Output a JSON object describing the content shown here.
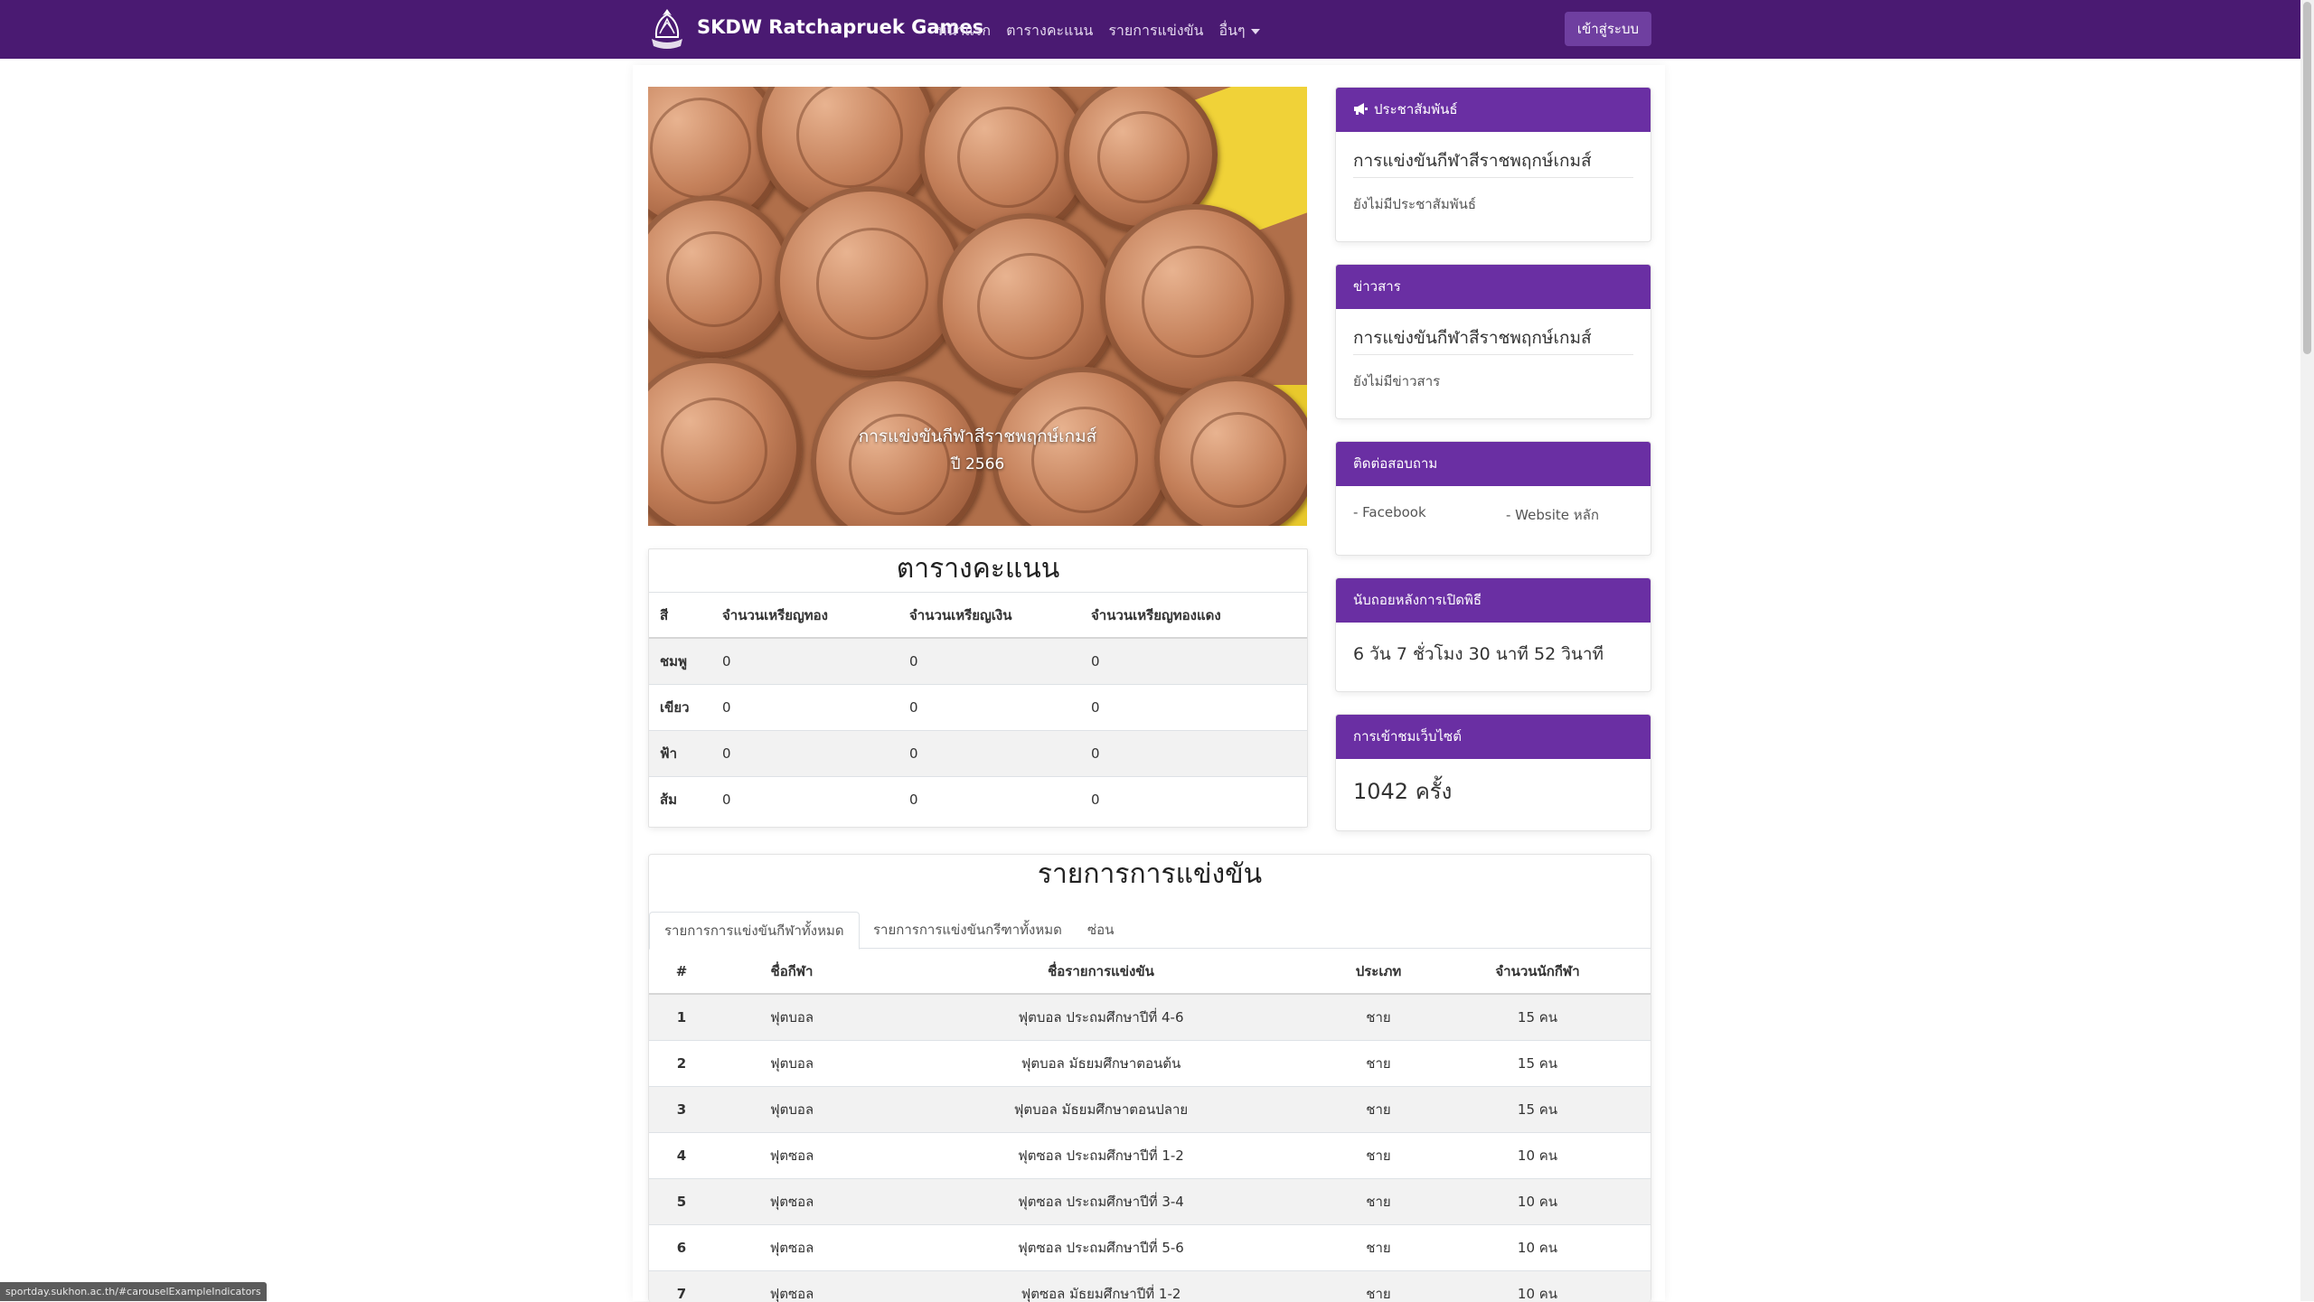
{
  "navbar": {
    "brand": "SKDW Ratchapruek Games",
    "links": [
      "หน้าแรก",
      "ตารางคะแนน",
      "รายการแข่งขัน",
      "อื่นๆ"
    ],
    "login": "เข้าสู่ระบบ"
  },
  "carousel": {
    "caption_title": "การแข่งขันกีฬาสีราชพฤกษ์เกมส์",
    "caption_sub": "ปี 2566"
  },
  "scoreboard": {
    "title": "ตารางคะแนน",
    "headers": [
      "สี",
      "จำนวนเหรียญทอง",
      "จำนวนเหรียญเงิน",
      "จำนวนเหรียญทองแดง"
    ],
    "rows": [
      [
        "ชมพู",
        "0",
        "0",
        "0"
      ],
      [
        "เขียว",
        "0",
        "0",
        "0"
      ],
      [
        "ฟ้า",
        "0",
        "0",
        "0"
      ],
      [
        "ส้ม",
        "0",
        "0",
        "0"
      ]
    ]
  },
  "announcements": {
    "title": "ประชาสัมพันธ์",
    "heading": "การแข่งขันกีฬาสีราชพฤกษ์เกมส์",
    "empty": "ยังไม่มีประชาสัมพันธ์"
  },
  "news": {
    "title": "ข่าวสาร",
    "heading": "การแข่งขันกีฬาสีราชพฤกษ์เกมส์",
    "empty": "ยังไม่มีข่าวสาร"
  },
  "contact": {
    "title": "ติดต่อสอบถาม",
    "facebook": "- Facebook",
    "website": "- Website หลัก"
  },
  "countdown": {
    "title": "นับถอยหลังการเปิดพิธี",
    "value": "6 วัน 7 ชั่วโมง 30 นาที 52 วินาที"
  },
  "visits": {
    "title": "การเข้าชมเว็บไซต์",
    "value": "1042 ครั้ง"
  },
  "competitions": {
    "title": "รายการการแข่งขัน",
    "tabs": [
      "รายการการแข่งขันกีฬาทั้งหมด",
      "รายการการแข่งขันกรีฑาทั้งหมด",
      "ซ่อน"
    ],
    "headers": [
      "#",
      "ชื่อกีฬา",
      "ชื่อรายการแข่งขัน",
      "ประเภท",
      "จำนวนนักกีฬา"
    ],
    "rows": [
      [
        "1",
        "ฟุตบอล",
        "ฟุตบอล ประถมศึกษาปีที่ 4-6",
        "ชาย",
        "15 คน"
      ],
      [
        "2",
        "ฟุตบอล",
        "ฟุตบอล มัธยมศึกษาตอนต้น",
        "ชาย",
        "15 คน"
      ],
      [
        "3",
        "ฟุตบอล",
        "ฟุตบอล มัธยมศึกษาตอนปลาย",
        "ชาย",
        "15 คน"
      ],
      [
        "4",
        "ฟุตซอล",
        "ฟุตซอล ประถมศึกษาปีที่ 1-2",
        "ชาย",
        "10 คน"
      ],
      [
        "5",
        "ฟุตซอล",
        "ฟุตซอล ประถมศึกษาปีที่ 3-4",
        "ชาย",
        "10 คน"
      ],
      [
        "6",
        "ฟุตซอล",
        "ฟุตซอล ประถมศึกษาปีที่ 5-6",
        "ชาย",
        "10 คน"
      ],
      [
        "7",
        "ฟุตซอล",
        "ฟุตซอล มัธยมศึกษาปีที่ 1-2",
        "ชาย",
        "10 คน"
      ]
    ]
  },
  "status_url": "sportday.sukhon.ac.th/#carouselExampleIndicators",
  "colors": {
    "navbar": "#4a1a72",
    "card_header": "#6a2fa3",
    "button": "#6f3fa0"
  }
}
